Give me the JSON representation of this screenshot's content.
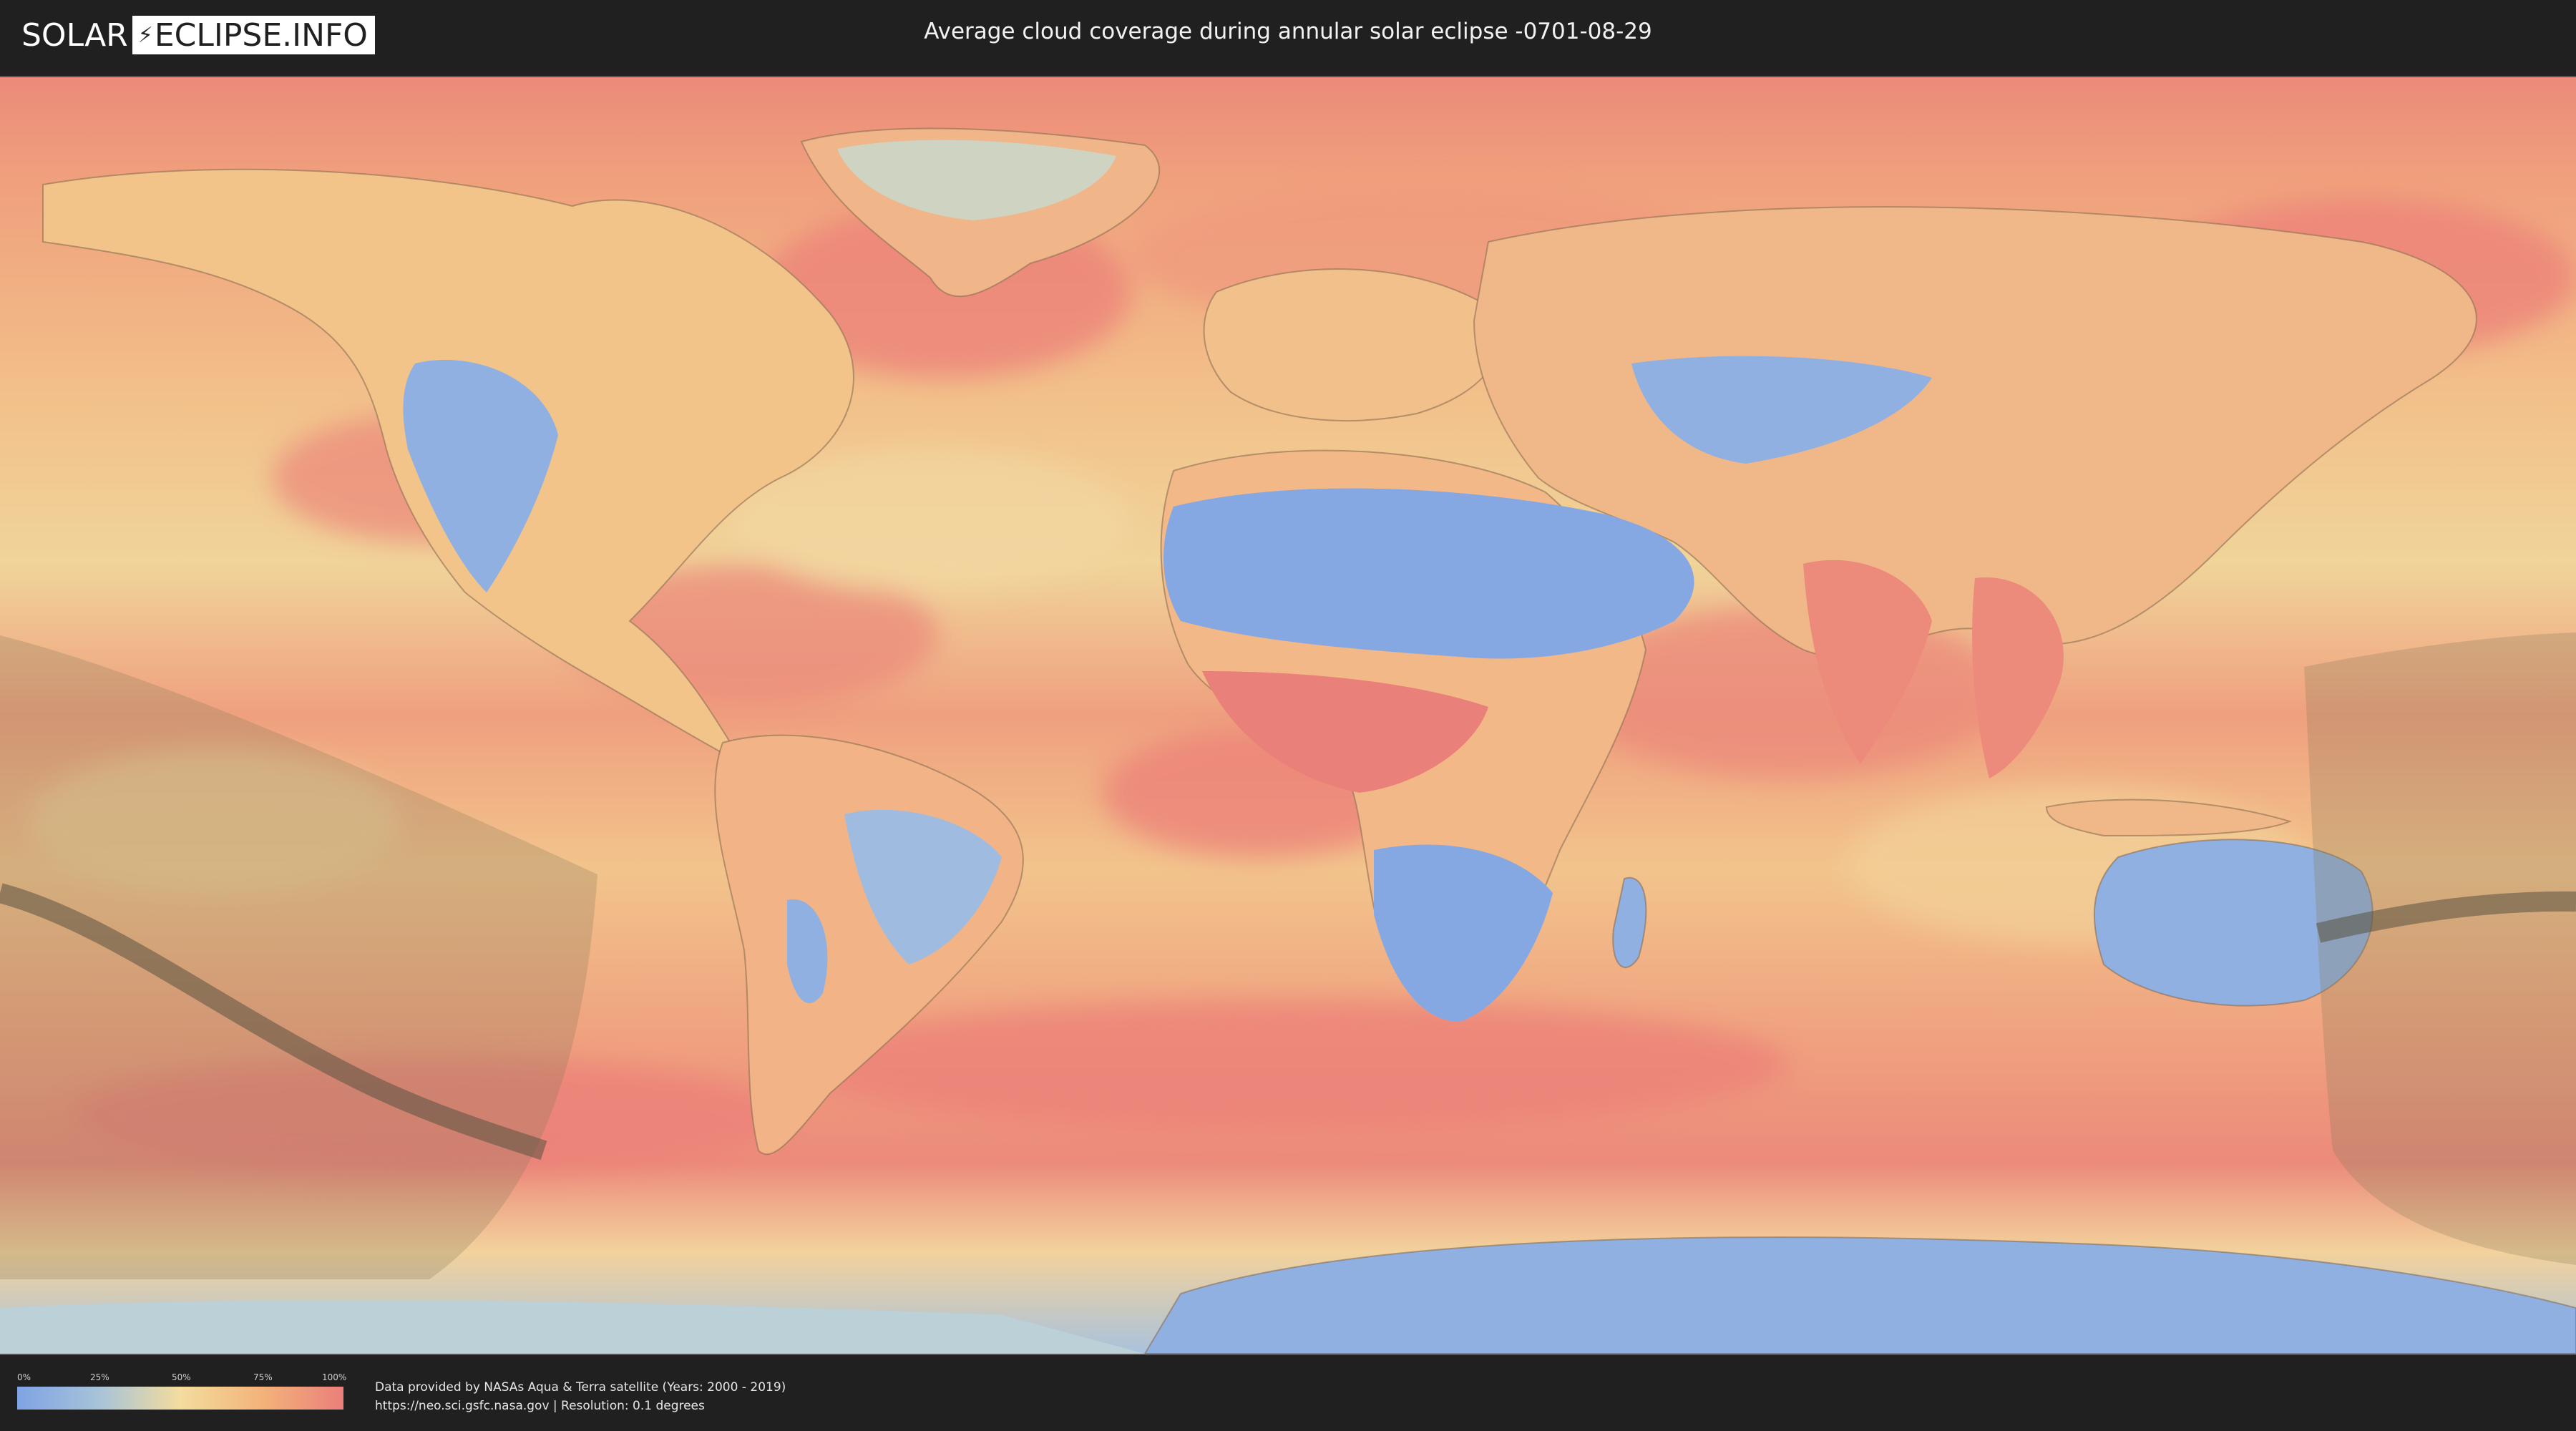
{
  "header": {
    "logo_left": "SOLAR",
    "logo_right": "ECLIPSE.INFO",
    "title": "Average cloud coverage during annular solar eclipse -0701-08-29"
  },
  "map": {
    "colors": {
      "clear": "#7ea4e4",
      "low": "#a7c3d9",
      "mid": "#f3dc9e",
      "high": "#f3b37a",
      "overcast": "#eb7f7a",
      "eclipse_shadow": "#8a7a5a",
      "eclipse_path": "#5a5240"
    }
  },
  "footer": {
    "legend": {
      "ticks": [
        "0%",
        "25%",
        "50%",
        "75%",
        "100%"
      ],
      "gradient_colors": [
        "#7ea4e4",
        "#a7c3d9",
        "#f3dc9e",
        "#f3b37a",
        "#eb7f7a"
      ]
    },
    "credit_line1": "Data provided by NASAs Aqua & Terra satellite (Years: 2000 - 2019)",
    "credit_line2": "https://neo.sci.gsfc.nasa.gov | Resolution: 0.1 degrees"
  }
}
